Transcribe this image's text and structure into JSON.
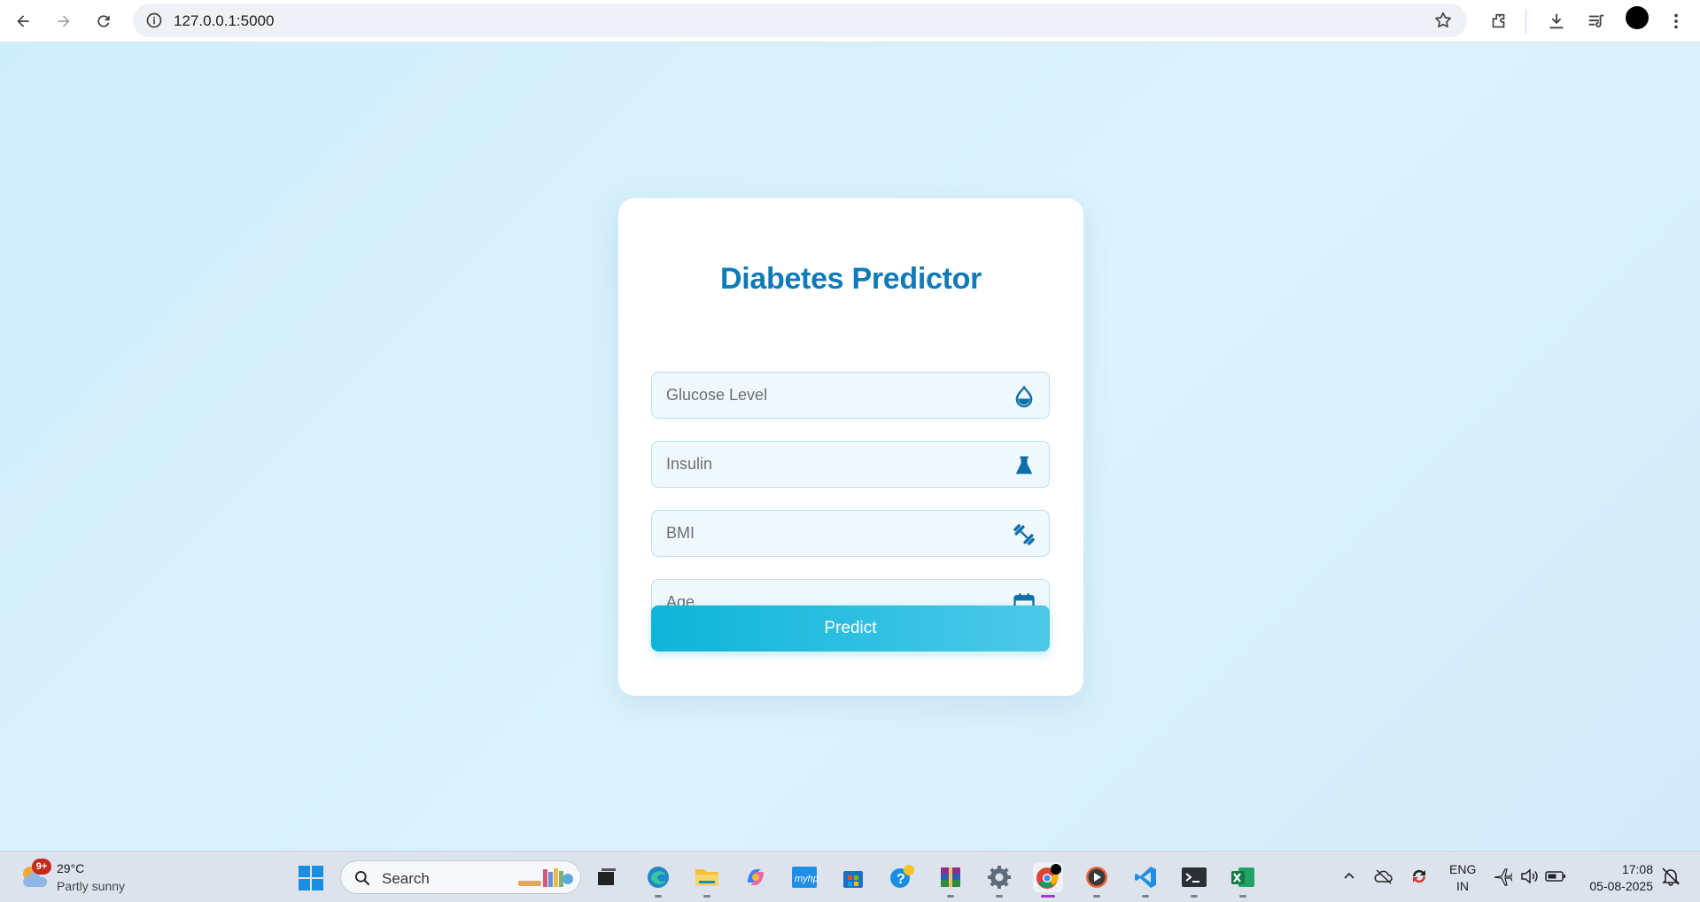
{
  "browser": {
    "url": "127.0.0.1:5000",
    "icons": [
      "back-icon",
      "forward-icon",
      "reload-icon",
      "site-info-icon",
      "bookmark-star-icon",
      "extensions-icon",
      "download-icon",
      "media-controls-icon",
      "profile-avatar",
      "more-menu-icon"
    ]
  },
  "form": {
    "title": "Diabetes Predictor",
    "fields": [
      {
        "placeholder": "Glucose Level",
        "icon": "droplet-icon"
      },
      {
        "placeholder": "Insulin",
        "icon": "flask-icon"
      },
      {
        "placeholder": "BMI",
        "icon": "dumbbell-icon"
      },
      {
        "placeholder": "Age",
        "icon": "calendar-icon"
      }
    ],
    "submit_label": "Predict"
  },
  "colors": {
    "accent": "#0e7ab8",
    "button_start": "#0db5da",
    "button_end": "#4dc9e8",
    "page_bg": "#d5effb"
  },
  "taskbar": {
    "weather": {
      "badge": "9+",
      "temp": "29°C",
      "desc": "Partly sunny"
    },
    "search_label": "Search",
    "apps": [
      "task-view-icon",
      "edge-icon",
      "file-explorer-icon",
      "copilot-icon",
      "myhp-icon",
      "store-icon",
      "help-icon",
      "winrar-icon",
      "settings-icon",
      "chrome-icon",
      "media-player-icon",
      "vscode-icon",
      "terminal-icon",
      "excel-icon"
    ],
    "tray": {
      "lang_top": "ENG",
      "lang_bottom": "IN",
      "time": "17:08",
      "date": "05-08-2025"
    }
  }
}
